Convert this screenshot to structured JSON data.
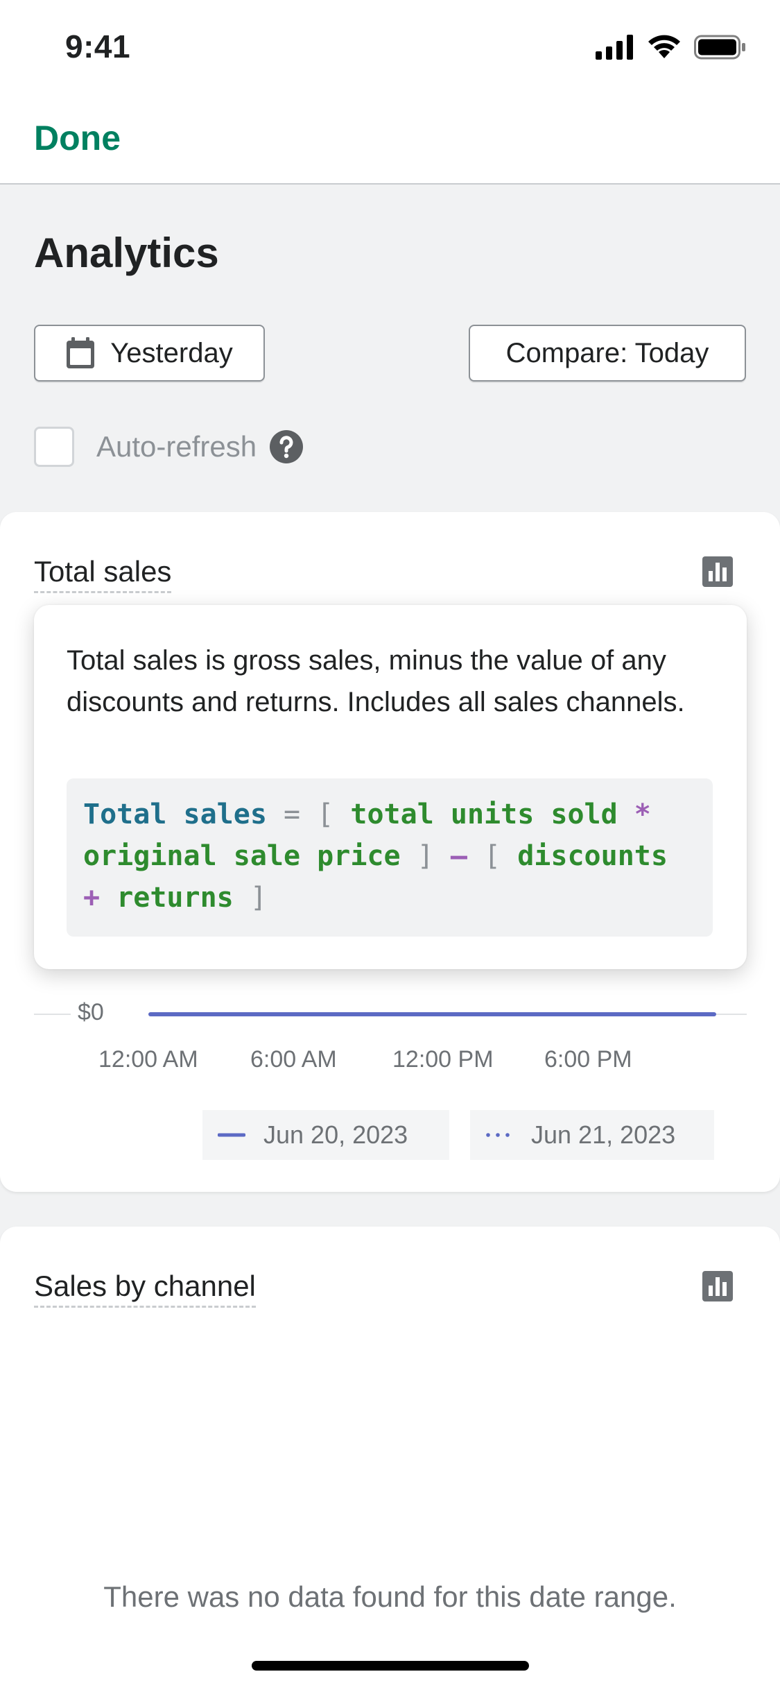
{
  "status_bar": {
    "time": "9:41"
  },
  "nav": {
    "done_label": "Done"
  },
  "header": {
    "title": "Analytics",
    "date_button_label": "Yesterday",
    "compare_button_label": "Compare: Today",
    "autorefresh_label": "Auto-refresh",
    "autorefresh_checked": false
  },
  "total_sales": {
    "title": "Total sales",
    "tooltip_text": "Total sales is gross sales, minus the value of any discounts and returns. Includes all sales channels.",
    "formula": {
      "t1": "Total sales",
      "t2": "=",
      "t3": "[",
      "t4": "total units sold",
      "t5": "*",
      "t6": "original sale price",
      "t7": "]",
      "t8": "–",
      "t9": "[",
      "t10": "discounts",
      "t11": "+",
      "t12": "returns",
      "t13": "]"
    },
    "chart": {
      "y_label": "$0",
      "x_labels": [
        "12:00 AM",
        "6:00 AM",
        "12:00 PM",
        "6:00 PM"
      ],
      "legend": [
        "Jun 20, 2023",
        "Jun 21, 2023"
      ],
      "line_color": "#5c6ac4"
    }
  },
  "sales_by_channel": {
    "title": "Sales by channel",
    "empty_message": "There was no data found for this date range."
  },
  "colors": {
    "accent": "#008060",
    "chart_primary": "#5c6ac4",
    "chart_secondary": "#47c1bf"
  }
}
